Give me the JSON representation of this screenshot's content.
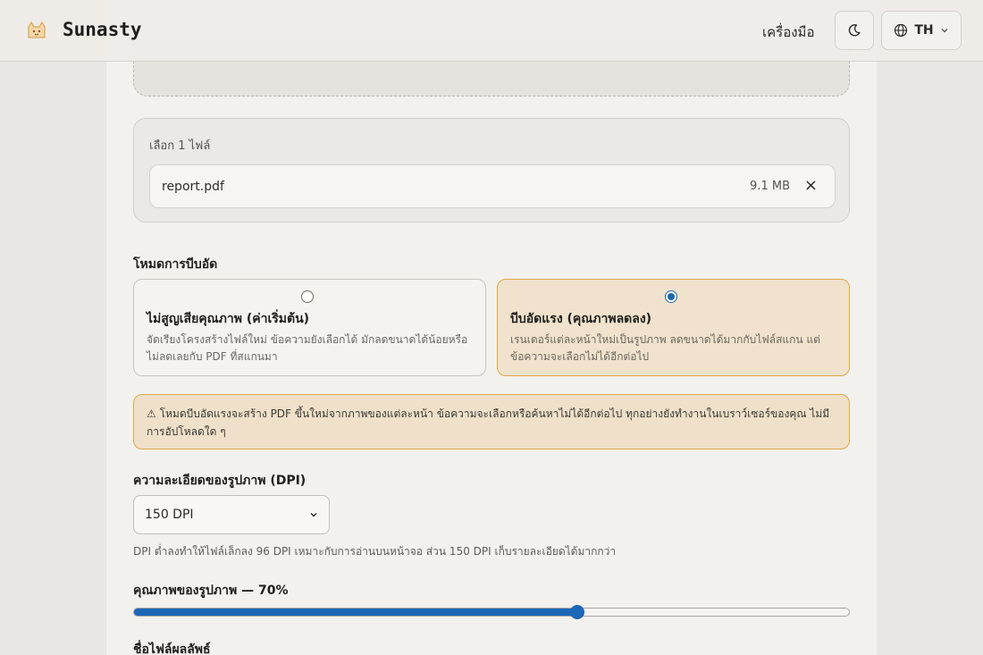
{
  "header": {
    "brand": "Sunasty",
    "tools_label": "เครื่องมือ",
    "language": "TH"
  },
  "files": {
    "count_label": "เลือก 1 ไฟล์",
    "items": [
      {
        "name": "report.pdf",
        "size": "9.1 MB",
        "remove": "×"
      }
    ]
  },
  "compression": {
    "label": "โหมดการบีบอัด",
    "options": [
      {
        "title": "ไม่สูญเสียคุณภาพ (ค่าเริ่มต้น)",
        "desc": "จัดเรียงโครงสร้างไฟล์ใหม่ ข้อความยังเลือกได้ มักลดขนาดได้น้อยหรือไม่ลดเลยกับ PDF ที่สแกนมา",
        "selected": false
      },
      {
        "title": "บีบอัดแรง (คุณภาพลดลง)",
        "desc": "เรนเดอร์แต่ละหน้าใหม่เป็นรูปภาพ ลดขนาดได้มากกับไฟล์สแกน แต่ข้อความจะเลือกไม่ได้อีกต่อไป",
        "selected": true
      }
    ],
    "warning": "⚠ โหมดบีบอัดแรงจะสร้าง PDF ขึ้นใหม่จากภาพของแต่ละหน้า ข้อความจะเลือกหรือค้นหาไม่ได้อีกต่อไป ทุกอย่างยังทำงานในเบราว์เซอร์ของคุณ ไม่มีการอัปโหลดใด ๆ"
  },
  "dpi": {
    "label": "ความละเอียดของรูปภาพ (DPI)",
    "selected": "150 DPI",
    "hint": "DPI ต่ำลงทำให้ไฟล์เล็กลง 96 DPI เหมาะกับการอ่านบนหน้าจอ ส่วน 150 DPI เก็บรายละเอียดได้มากกว่า"
  },
  "quality": {
    "label": "คุณภาพของรูปภาพ — 70%",
    "value": 0.62
  },
  "output": {
    "label": "ชื่อไฟล์ผลลัพธ์"
  },
  "colors": {
    "accent": "#1c66b6",
    "warning_border": "#e0a94a",
    "warning_bg": "#efe0c9"
  }
}
